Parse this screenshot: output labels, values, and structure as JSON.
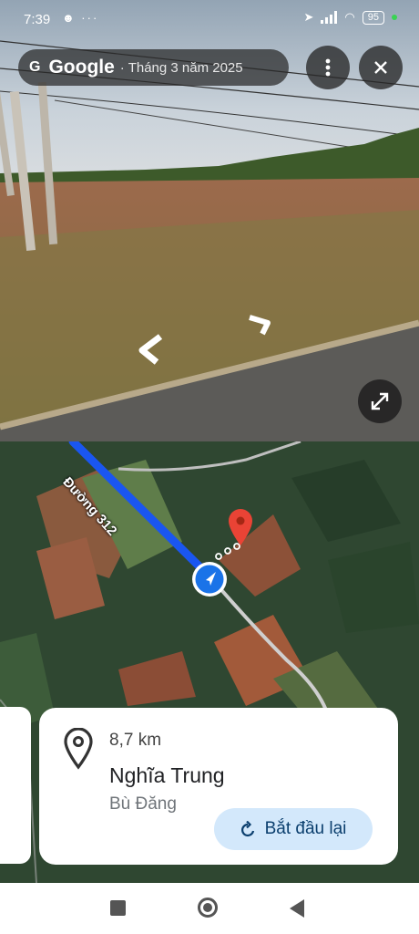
{
  "status_bar": {
    "time": "7:39",
    "notif_icons": "☻ ···",
    "battery": "95"
  },
  "streetview": {
    "brand_g": "G",
    "brand": "Google",
    "date": "· Tháng 3 năm 2025",
    "more_icon": "more-vert-icon",
    "close_icon": "close-icon",
    "expand_icon": "expand-icon"
  },
  "map": {
    "road_label": "Đường 312"
  },
  "route_card": {
    "distance": "8,7 km",
    "place": "Nghĩa Trung",
    "region": "Bù Đăng",
    "restart_label": "Bắt đầu lại"
  },
  "colors": {
    "route_blue": "#1a56f0",
    "pin_red": "#ea4335",
    "button_bg": "#d3e8fb"
  }
}
